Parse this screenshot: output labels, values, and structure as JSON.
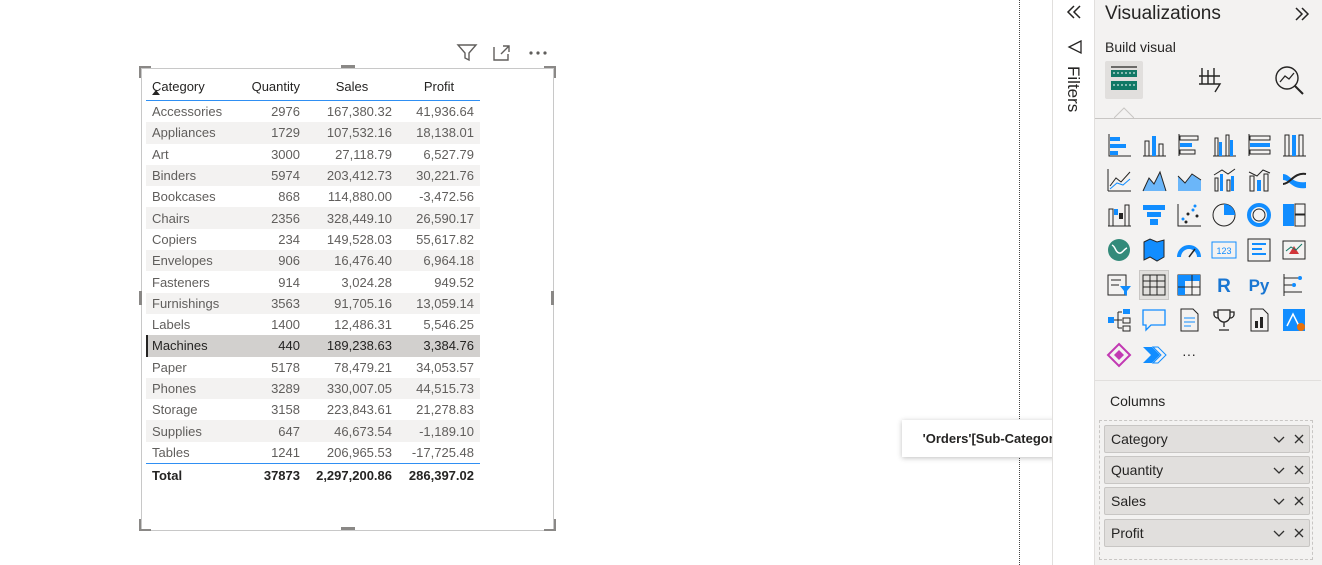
{
  "table": {
    "headers": [
      "Category",
      "Quantity",
      "Sales",
      "Profit"
    ],
    "rows": [
      [
        "Accessories",
        "2976",
        "167,380.32",
        "41,936.64"
      ],
      [
        "Appliances",
        "1729",
        "107,532.16",
        "18,138.01"
      ],
      [
        "Art",
        "3000",
        "27,118.79",
        "6,527.79"
      ],
      [
        "Binders",
        "5974",
        "203,412.73",
        "30,221.76"
      ],
      [
        "Bookcases",
        "868",
        "114,880.00",
        "-3,472.56"
      ],
      [
        "Chairs",
        "2356",
        "328,449.10",
        "26,590.17"
      ],
      [
        "Copiers",
        "234",
        "149,528.03",
        "55,617.82"
      ],
      [
        "Envelopes",
        "906",
        "16,476.40",
        "6,964.18"
      ],
      [
        "Fasteners",
        "914",
        "3,024.28",
        "949.52"
      ],
      [
        "Furnishings",
        "3563",
        "91,705.16",
        "13,059.14"
      ],
      [
        "Labels",
        "1400",
        "12,486.31",
        "5,546.25"
      ],
      [
        "Machines",
        "440",
        "189,238.63",
        "3,384.76"
      ],
      [
        "Paper",
        "5178",
        "78,479.21",
        "34,053.57"
      ],
      [
        "Phones",
        "3289",
        "330,007.05",
        "44,515.73"
      ],
      [
        "Storage",
        "3158",
        "223,843.61",
        "21,278.83"
      ],
      [
        "Supplies",
        "647",
        "46,673.54",
        "-1,189.10"
      ],
      [
        "Tables",
        "1241",
        "206,965.53",
        "-17,725.48"
      ]
    ],
    "selected_row": "Machines",
    "total": [
      "Total",
      "37873",
      "2,297,200.86",
      "286,397.02"
    ]
  },
  "visual_header_icons": [
    "filter-icon",
    "focus-mode-icon",
    "more-options-icon"
  ],
  "tooltip": {
    "text": "'Orders'[Sub-Category]"
  },
  "filters_pane": {
    "label": "Filters"
  },
  "visualizations_pane": {
    "title": "Visualizations",
    "build_label": "Build visual",
    "tabs": [
      "build-visual-icon",
      "format-visual-icon",
      "analytics-icon"
    ],
    "r_label": "R",
    "py_label": "Py",
    "kpi_label": "123",
    "more_label": "···",
    "columns_label": "Columns",
    "fields": [
      "Category",
      "Quantity",
      "Sales",
      "Profit"
    ]
  },
  "colors": {
    "accent": "#118dff",
    "header_line": "#2f8ff3",
    "pane_bg": "#f3f2f1",
    "selected_row": "#d2d0ce"
  }
}
